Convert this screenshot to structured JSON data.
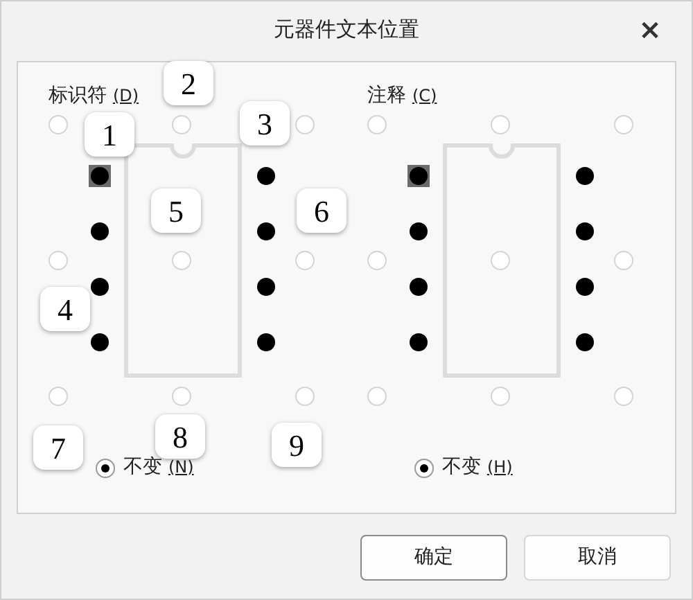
{
  "window": {
    "title": "元器件文本位置",
    "close": "×"
  },
  "sections": [
    {
      "label": "标识符",
      "access_key": "(D)",
      "positions": [
        {
          "selected": false
        },
        {
          "selected": false
        },
        {
          "selected": false
        },
        {
          "selected": false
        },
        {
          "selected": false
        },
        {
          "selected": false
        },
        {
          "selected": false
        },
        {
          "selected": false
        },
        {
          "selected": false
        }
      ],
      "unchanged": {
        "label": "不变",
        "access_key": "(N)",
        "selected": true
      }
    },
    {
      "label": "注释",
      "access_key": "(C)",
      "positions": [
        {
          "selected": false
        },
        {
          "selected": false
        },
        {
          "selected": false
        },
        {
          "selected": false
        },
        {
          "selected": false
        },
        {
          "selected": false
        },
        {
          "selected": false
        },
        {
          "selected": false
        },
        {
          "selected": false
        }
      ],
      "unchanged": {
        "label": "不变",
        "access_key": "(H)",
        "selected": true
      }
    }
  ],
  "callouts": [
    {
      "label": "1"
    },
    {
      "label": "2"
    },
    {
      "label": "3"
    },
    {
      "label": "4"
    },
    {
      "label": "5"
    },
    {
      "label": "6"
    },
    {
      "label": "7"
    },
    {
      "label": "8"
    },
    {
      "label": "9"
    }
  ],
  "buttons": [
    "确定",
    "取消"
  ]
}
